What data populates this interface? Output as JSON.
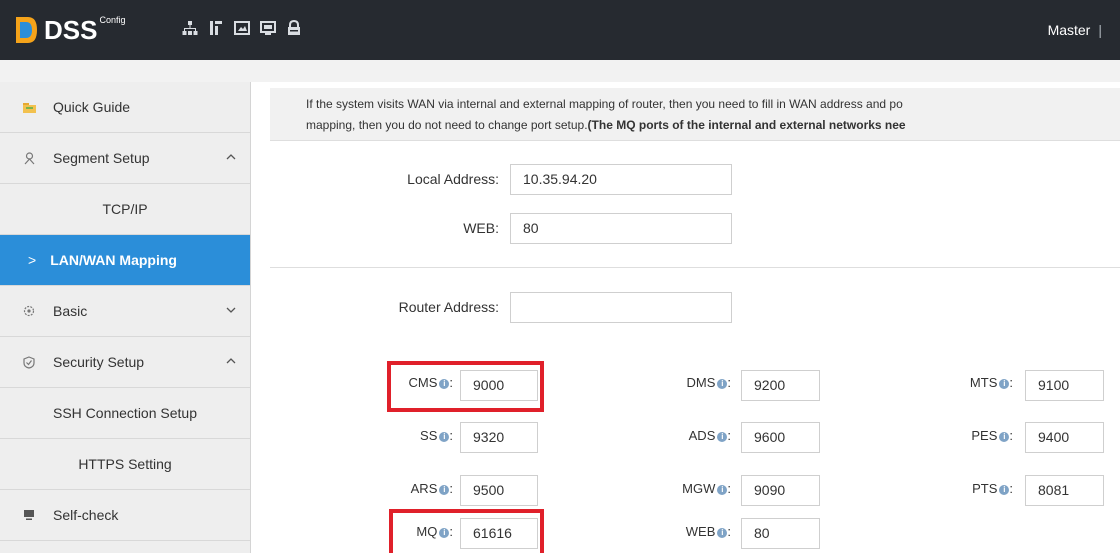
{
  "header": {
    "logo_text": "DSS",
    "logo_sup": "Config",
    "user": "Master",
    "separator": "|",
    "icons": [
      "network-icon",
      "layout-icon",
      "image-icon",
      "monitor-icon",
      "lock-icon"
    ]
  },
  "sidebar": {
    "items": [
      {
        "label": "Quick Guide",
        "icon": "folder-icon"
      },
      {
        "label": "Segment Setup",
        "icon": "segment-icon",
        "expanded": true
      },
      {
        "label": "TCP/IP",
        "sub": true
      },
      {
        "label": "LAN/WAN Mapping",
        "sub": true,
        "active": true,
        "marker": ">"
      },
      {
        "label": "Basic",
        "icon": "gear-icon",
        "expanded": false
      },
      {
        "label": "Security Setup",
        "icon": "shield-icon",
        "expanded": true
      },
      {
        "label": "SSH Connection Setup",
        "sub": true
      },
      {
        "label": "HTTPS Setting",
        "sub": true
      },
      {
        "label": "Self-check",
        "icon": "monitor-icon"
      }
    ]
  },
  "info": {
    "line1": "If the system visits WAN via internal and external mapping of router, then you need to fill in WAN address and po",
    "line2_normal": "mapping, then you do not need to change port setup.",
    "line2_bold": "(The MQ ports of the internal and external networks nee"
  },
  "form": {
    "local_address": {
      "label": "Local Address:",
      "value": "10.35.94.20"
    },
    "web": {
      "label": "WEB:",
      "value": "80"
    },
    "router_address": {
      "label": "Router Address:",
      "value": ""
    }
  },
  "ports": [
    {
      "name": "CMS",
      "value": "9000",
      "highlighted": true
    },
    {
      "name": "DMS",
      "value": "9200"
    },
    {
      "name": "MTS",
      "value": "9100"
    },
    {
      "name": "SS",
      "value": "9320"
    },
    {
      "name": "ADS",
      "value": "9600"
    },
    {
      "name": "PES",
      "value": "9400"
    },
    {
      "name": "ARS",
      "value": "9500"
    },
    {
      "name": "MGW",
      "value": "9090"
    },
    {
      "name": "PTS",
      "value": "8081"
    },
    {
      "name": "MQ",
      "value": "61616",
      "highlighted": true
    },
    {
      "name": "WEB",
      "value": "80"
    }
  ],
  "port_label_suffix": ":",
  "info_glyph": "i",
  "colors": {
    "header_bg": "#262a30",
    "active_bg": "#2b8ed9",
    "highlight": "#e0202a"
  }
}
